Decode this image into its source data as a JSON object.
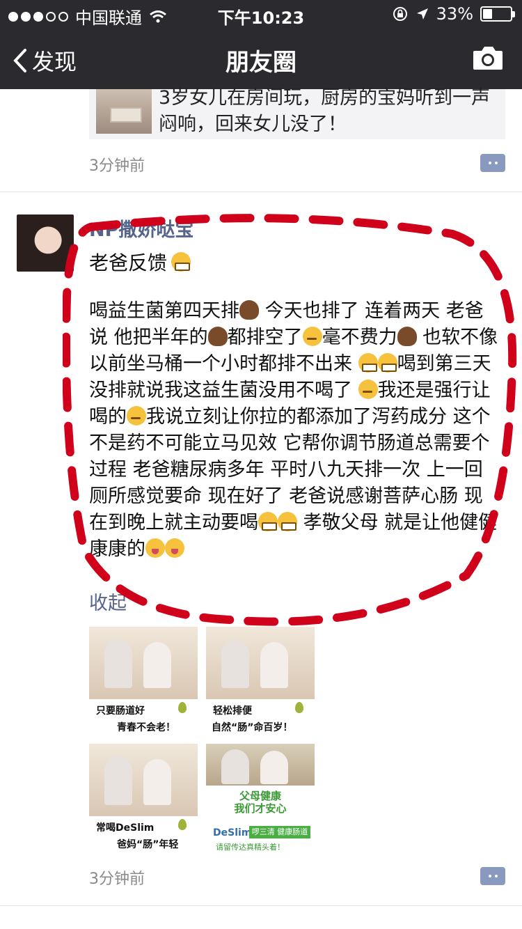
{
  "status_bar": {
    "carrier": "中国联通",
    "time": "下午10:23",
    "battery": "33%",
    "battery_level": 0.33
  },
  "nav": {
    "back_label": "发现",
    "title": "朋友圈"
  },
  "prev_post": {
    "link_text": "3岁女儿在房间玩，厨房的宝妈听到一声闷响，回来女儿没了！",
    "time": "3分钟前"
  },
  "post": {
    "username": "NP撒娇哒宝",
    "title": "老爸反馈",
    "body_segments": [
      "喝益生菌第四天排",
      " 今天也排了 连着两天 老爸说 他把半年的",
      "都排空了",
      "毫不费力",
      " 也软不像以前坐马桶一个小时都排不出来 ",
      "喝到第三天没排就说我这益生菌没用不喝了 ",
      "我还是强行让喝的",
      "我说立刻让你拉的都添加了泻药成分 这个不是药不可能立马见效 它帮你调节肠道总需要个过程 老爸糖尿病多年 平时八九天排一次 上一回厕所感觉要命 现在好了 老爸说感谢菩萨心肠 现在到晚上就主动要喝",
      " 孝敬父母 就是让他健健康康的"
    ],
    "collapse_label": "收起",
    "time": "3分钟前",
    "images": [
      {
        "line1": "只要肠道好",
        "line2": "青春不会老！"
      },
      {
        "line1": "轻松排便",
        "line2": "自然“肠”命百岁！"
      },
      {
        "line1": "常喝DeSlim",
        "line2": "爸妈“肠”年轻"
      },
      {
        "line1": "父母健康",
        "line2": "我们才安心",
        "brand": "DeSlim",
        "tag": "啰三清 健康肠道",
        "sub": "请留传达真精头着！"
      }
    ]
  },
  "colors": {
    "nav_bg": "#2b2a2f",
    "link_blue": "#56648c",
    "annotation_red": "#d0021b"
  },
  "icons": [
    "back-chevron-icon",
    "camera-icon",
    "wifi-icon",
    "lock-rotation-icon",
    "location-arrow-icon",
    "comment-icon"
  ]
}
